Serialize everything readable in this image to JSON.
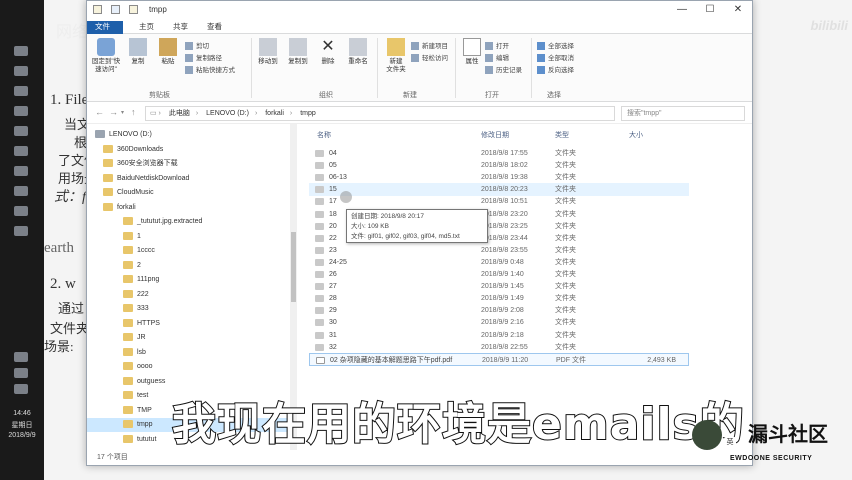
{
  "window": {
    "title": "tmpp",
    "tabs": [
      "文件",
      "主页",
      "共享",
      "查看"
    ],
    "ribbon": {
      "clipboard": {
        "label": "剪贴板",
        "pin": "固定到\"快\n速访问\"",
        "copy": "复制",
        "paste": "粘贴",
        "cut": "剪切",
        "copy_path": "复制路径",
        "paste_shortcut": "粘贴快捷方式"
      },
      "organize": {
        "label": "组织",
        "move_to": "移动到",
        "copy_to": "复制到",
        "delete": "删除",
        "rename": "重命名"
      },
      "new": {
        "label": "新建",
        "new_folder": "新建\n文件夹",
        "new_item": "新建项目",
        "easy_access": "轻松访问"
      },
      "open": {
        "label": "打开",
        "properties": "属性",
        "open": "打开",
        "edit": "编辑",
        "history": "历史记录"
      },
      "select": {
        "label": "选择",
        "select_all": "全部选择",
        "select_none": "全部取消",
        "invert": "反向选择"
      }
    },
    "address": [
      "此电脑",
      "LENOVO (D:)",
      "forkali",
      "tmpp"
    ],
    "search_placeholder": "搜索\"tmpp\"",
    "columns": {
      "name": "名称",
      "date": "修改日期",
      "type": "类型",
      "size": "大小"
    },
    "tree": [
      "LENOVO (D:)",
      "360Downloads",
      "360安全浏览器下载",
      "BaiduNetdiskDownload",
      "CloudMusic",
      "forkali",
      "_tututut.jpg.extracted",
      "1",
      "1cccc",
      "2",
      "111png",
      "222",
      "333",
      "HTTPS",
      "JR",
      "lsb",
      "oooo",
      "outguess",
      "test",
      "TMP",
      "tmpp",
      "tututut"
    ],
    "files": [
      {
        "name": "04",
        "date": "2018/9/8 17:55",
        "type": "文件夹",
        "size": ""
      },
      {
        "name": "05",
        "date": "2018/9/8 18:02",
        "type": "文件夹",
        "size": ""
      },
      {
        "name": "06-13",
        "date": "2018/9/8 19:38",
        "type": "文件夹",
        "size": ""
      },
      {
        "name": "15",
        "date": "2018/9/8 20:23",
        "type": "文件夹",
        "size": ""
      },
      {
        "name": "17",
        "date": "2018/9/8 10:51",
        "type": "文件夹",
        "size": ""
      },
      {
        "name": "18",
        "date": "2018/9/8 23:20",
        "type": "文件夹",
        "size": ""
      },
      {
        "name": "20",
        "date": "2018/9/8 23:25",
        "type": "文件夹",
        "size": ""
      },
      {
        "name": "22",
        "date": "2018/9/8 23:44",
        "type": "文件夹",
        "size": ""
      },
      {
        "name": "23",
        "date": "2018/9/8 23:55",
        "type": "文件夹",
        "size": ""
      },
      {
        "name": "24-25",
        "date": "2018/9/9 0:48",
        "type": "文件夹",
        "size": ""
      },
      {
        "name": "26",
        "date": "2018/9/9 1:40",
        "type": "文件夹",
        "size": ""
      },
      {
        "name": "27",
        "date": "2018/9/9 1:45",
        "type": "文件夹",
        "size": ""
      },
      {
        "name": "28",
        "date": "2018/9/9 1:49",
        "type": "文件夹",
        "size": ""
      },
      {
        "name": "29",
        "date": "2018/9/9 2:08",
        "type": "文件夹",
        "size": ""
      },
      {
        "name": "30",
        "date": "2018/9/9 2:16",
        "type": "文件夹",
        "size": ""
      },
      {
        "name": "31",
        "date": "2018/9/9 2:18",
        "type": "文件夹",
        "size": ""
      },
      {
        "name": "32",
        "date": "2018/9/8 22:55",
        "type": "文件夹",
        "size": ""
      },
      {
        "name": "02 杂项隐藏的基本解题思路下午pdf.pdf",
        "date": "2018/9/9 11:20",
        "type": "PDF 文件",
        "size": "2,493 KB"
      }
    ],
    "tooltip": {
      "created": "创建日期: 2018/9/8 20:17",
      "size": "大小: 109 KB",
      "files": "文件: gif01, gif02, gif03, gif04, md5.txt"
    },
    "status": "17 个项目"
  },
  "taskbar": {
    "time": "14:46",
    "weekday": "星期日",
    "date": "2018/9/9"
  },
  "background": {
    "lines": [
      "网络",
      "1. File",
      "当文件",
      "根据",
      "了文件",
      "用场景",
      "式：fil",
      "earth",
      "2. w",
      "通过",
      "文件夹",
      "场景:"
    ]
  },
  "subtitle": "我现在用的环境是emails的",
  "watermark": {
    "site": "bilibili",
    "brand": "漏斗社区",
    "brand_sub": "EWDOONE SECURITY",
    "ime": "英"
  },
  "colors": {
    "accent": "#1e5faa",
    "selected": "#cce8ff",
    "folder": "#e8c66a"
  }
}
